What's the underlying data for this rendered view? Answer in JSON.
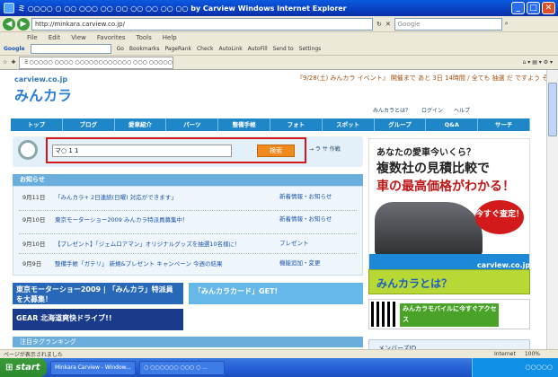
{
  "window": {
    "title": "ミ ○○○○ ○ ○○ ○○○ ○○ ○○ ○○ ○○ ○○ ○○ by Carview  Windows Internet Explorer",
    "controls": [
      "_",
      "□",
      "✕"
    ]
  },
  "address": {
    "url": "http://minkara.carview.co.jp/",
    "search_placeholder": "Google"
  },
  "menu": [
    "File",
    "Edit",
    "View",
    "Favorites",
    "Tools",
    "Help"
  ],
  "google_toolbar": {
    "label": "Google",
    "items": [
      "Go",
      "Bookmarks",
      "PageRank",
      "Check",
      "AutoLink",
      "AutoFill",
      "Send to",
      "Settings"
    ]
  },
  "tabs": [
    {
      "label": "ミ○○○○○ ○○○○ ○○○○○○○○○○○○ ○○○ ○○○○○"
    }
  ],
  "site": {
    "logo_small": "carview.co.jp",
    "logo": "みんカラ",
    "event": "『9/28(土) みんカラ イベント』 開催まで あと 3日 14時間 / 全ても 抽選 だ ですよう ぞ",
    "header_links": [
      "みんカラとは？",
      "ログイン",
      "ヘルプ"
    ],
    "nav": [
      "トップ",
      "ブログ",
      "愛車紹介",
      "パーツ",
      "整備手帳",
      "フォト",
      "スポット",
      "グループ",
      "Q&A",
      "サーチ"
    ]
  },
  "search": {
    "input_value": "マ○ 1 1",
    "button": "検索",
    "options": "→ ラ   サ   作戦"
  },
  "news": {
    "heading": "お知らせ",
    "items": [
      {
        "date": "9月11日",
        "title": "「みんカラ+ 2日連続(日曜) 対応ができます」",
        "category": "新着情報・お知らせ"
      },
      {
        "date": "9月10日",
        "title": "東京モーターショー2009 みんカラ特派員募集中！",
        "category": "新着情報・お知らせ"
      },
      {
        "date": "9月10日",
        "title": "【プレゼント】「ジェムロアマン」オリジナルグッズを抽選10名様に！",
        "category": "プレゼント"
      },
      {
        "date": "9月9日",
        "title": "整備手帳「ガテリ」 新規&プレゼント キャンペーン 今週の結果",
        "category": "機能追加・変更"
      }
    ]
  },
  "banners": {
    "tms": "東京モーターショー2009 | 「みんカラ」特派員を大募集！",
    "card": "「みんカラカード」GET!",
    "gear": "GEAR 北海道爽快ドライブ!!",
    "ranking": "注目タグランキング"
  },
  "ads": {
    "question": "あなたの愛車今いくら？",
    "line1": "複数社の見積比較で",
    "line2": "車の最高価格がわかる！",
    "stamp": "今すぐ査定！",
    "brand": "carview.co.jp",
    "minkara_to_ha": "みんカラとは？",
    "mobile": "みんカラモバイルに今すぐアクセス",
    "member": "メンバーズID"
  },
  "status": {
    "text": "ページが表示されました",
    "zone": "Internet",
    "zoom": "100%"
  },
  "taskbar": {
    "start": "start",
    "items": [
      "Minkara Carview - Window...",
      "○ ○○○○○○ ○○○ ○ ..."
    ],
    "clock": "○○○○○"
  }
}
